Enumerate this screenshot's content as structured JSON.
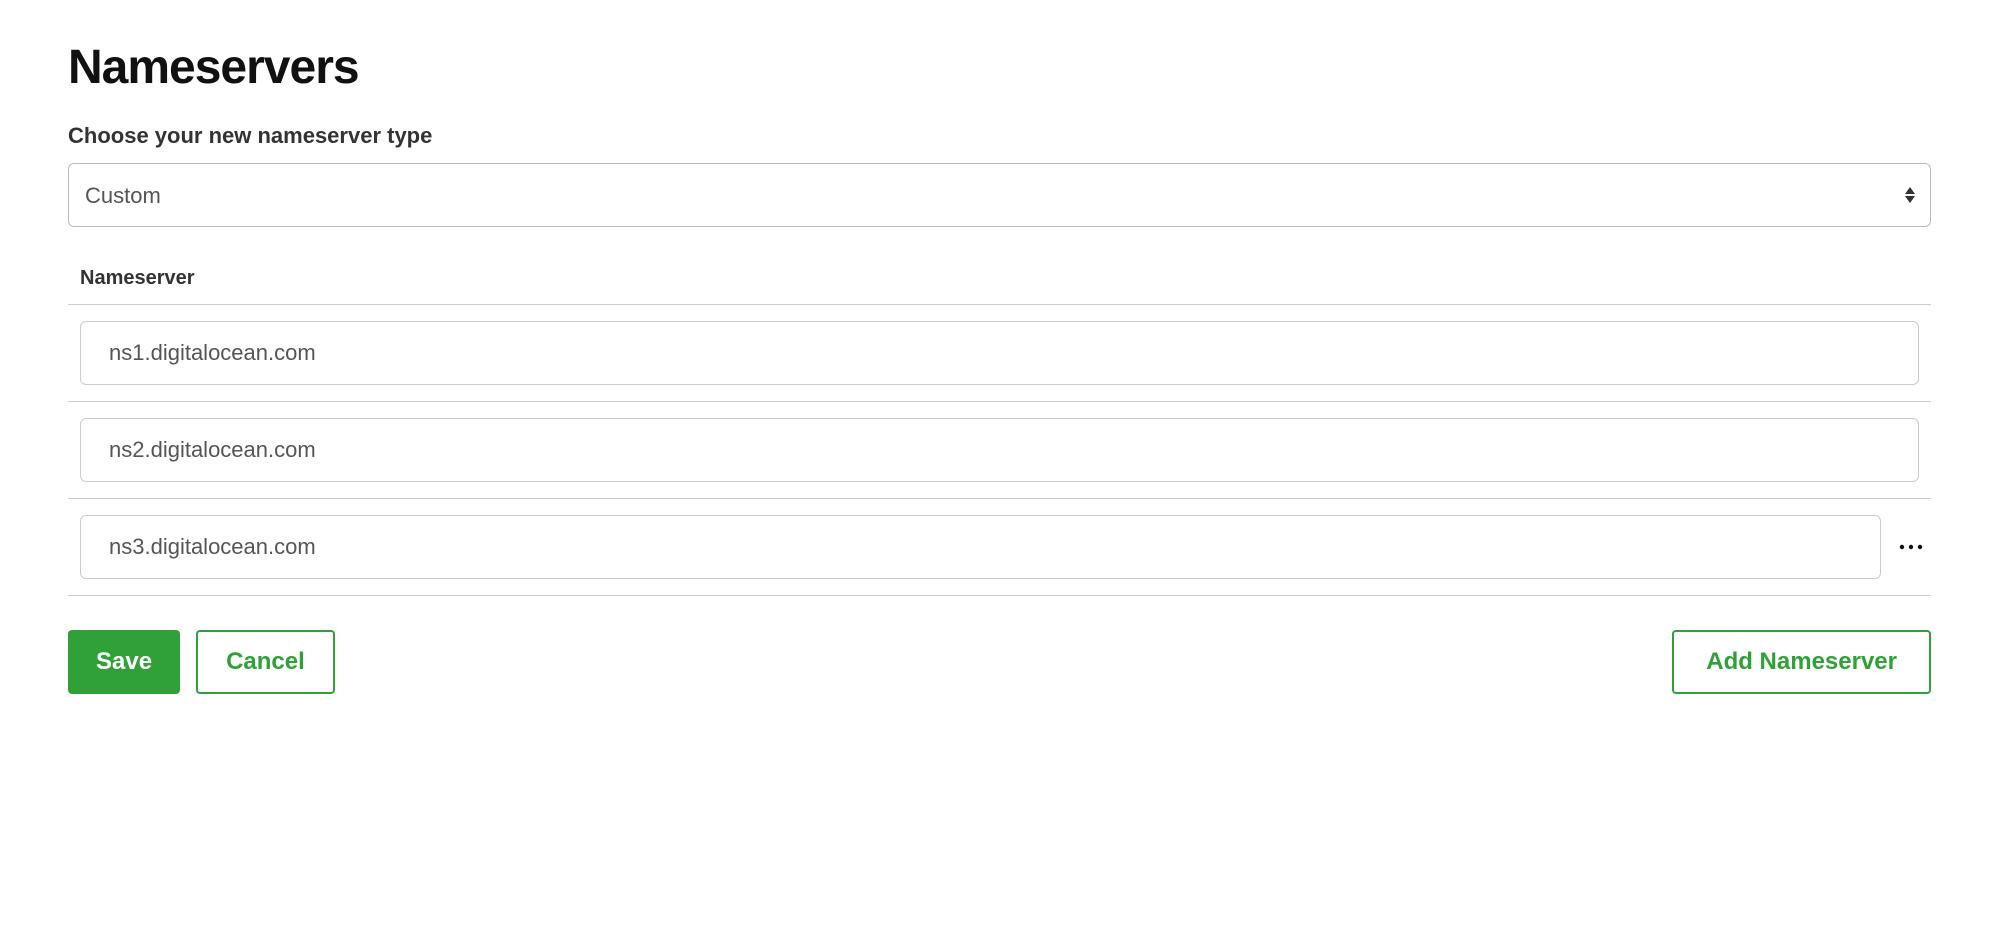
{
  "page": {
    "title": "Nameservers"
  },
  "type_selector": {
    "label": "Choose your new nameserver type",
    "selected": "Custom"
  },
  "nameservers": {
    "column_header": "Nameserver",
    "rows": [
      {
        "value": "ns1.digitalocean.com",
        "has_more": false
      },
      {
        "value": "ns2.digitalocean.com",
        "has_more": false
      },
      {
        "value": "ns3.digitalocean.com",
        "has_more": true
      }
    ]
  },
  "actions": {
    "save": "Save",
    "cancel": "Cancel",
    "add": "Add Nameserver"
  }
}
